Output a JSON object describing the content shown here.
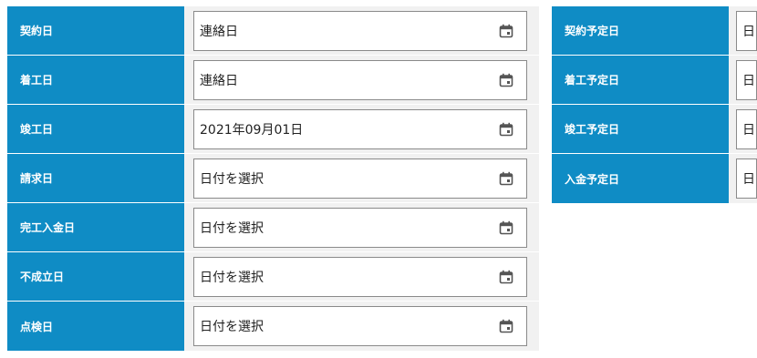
{
  "left_form": {
    "rows": [
      {
        "label": "契約日",
        "value": "連絡日"
      },
      {
        "label": "着工日",
        "value": "連絡日"
      },
      {
        "label": "竣工日",
        "value": "2021年09月01日"
      },
      {
        "label": "請求日",
        "value": "日付を選択"
      },
      {
        "label": "完工入金日",
        "value": "日付を選択"
      },
      {
        "label": "不成立日",
        "value": "日付を選択"
      },
      {
        "label": "点検日",
        "value": "日付を選択"
      }
    ]
  },
  "right_form": {
    "rows": [
      {
        "label": "契約予定日",
        "value": "日"
      },
      {
        "label": "着工予定日",
        "value": "日"
      },
      {
        "label": "竣工予定日",
        "value": "日"
      },
      {
        "label": "入金予定日",
        "value": "日"
      }
    ]
  },
  "icons": {
    "date_field": "calendar-icon"
  },
  "colors": {
    "label_bg": "#0f8cc5",
    "row_bg": "#f1f1f1",
    "field_border": "#8a8a8a"
  }
}
